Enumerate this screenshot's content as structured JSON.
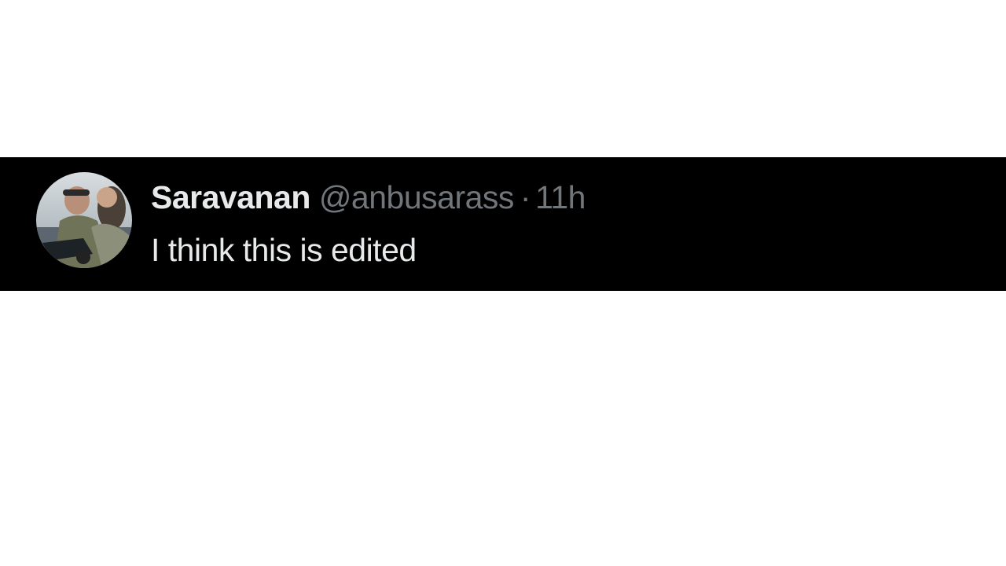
{
  "reply": {
    "avatar": {
      "icon": "user-avatar-photo"
    },
    "display_name": "Saravanan",
    "handle": "@anbusarass",
    "separator": "·",
    "time": "11h",
    "text": "I think this is edited"
  },
  "colors": {
    "strip_background": "#000000",
    "page_background": "#ffffff",
    "primary_text": "#e7e9ea",
    "secondary_text": "#71767b"
  }
}
